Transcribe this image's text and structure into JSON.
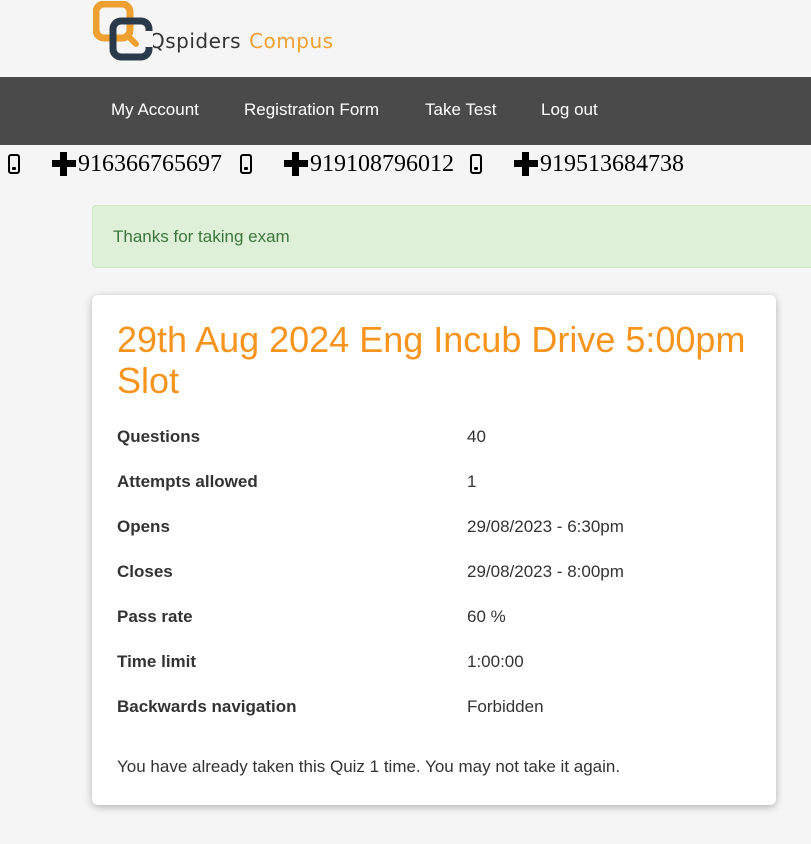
{
  "brand": {
    "name_part1": "Qspiders",
    "name_part2": "Compus",
    "logo_letters": "QC"
  },
  "nav": {
    "my_account": "My Account",
    "registration_form": "Registration Form",
    "take_test": "Take Test",
    "log_out": "Log out"
  },
  "contacts": [
    {
      "number": "916366765697"
    },
    {
      "number": "919108796012"
    },
    {
      "number": "919513684738"
    }
  ],
  "alert": {
    "message": "Thanks for taking exam"
  },
  "quiz": {
    "title": "29th Aug 2024 Eng Incub Drive 5:00pm Slot",
    "details": [
      {
        "label": "Questions",
        "value": "40"
      },
      {
        "label": "Attempts allowed",
        "value": "1"
      },
      {
        "label": "Opens",
        "value": "29/08/2023 - 6:30pm"
      },
      {
        "label": "Closes",
        "value": "29/08/2023 - 8:00pm"
      },
      {
        "label": "Pass rate",
        "value": "60 %"
      },
      {
        "label": "Time limit",
        "value": "1:00:00"
      },
      {
        "label": "Backwards navigation",
        "value": "Forbidden"
      }
    ],
    "note": "You have already taken this Quiz 1 time. You may not take it again."
  },
  "colors": {
    "accent_orange": "#f7941d",
    "logo_dark": "#2b3a4a",
    "navbar_bg": "#4a4a4a",
    "alert_bg": "#dff0d8",
    "alert_text": "#3c763d"
  }
}
